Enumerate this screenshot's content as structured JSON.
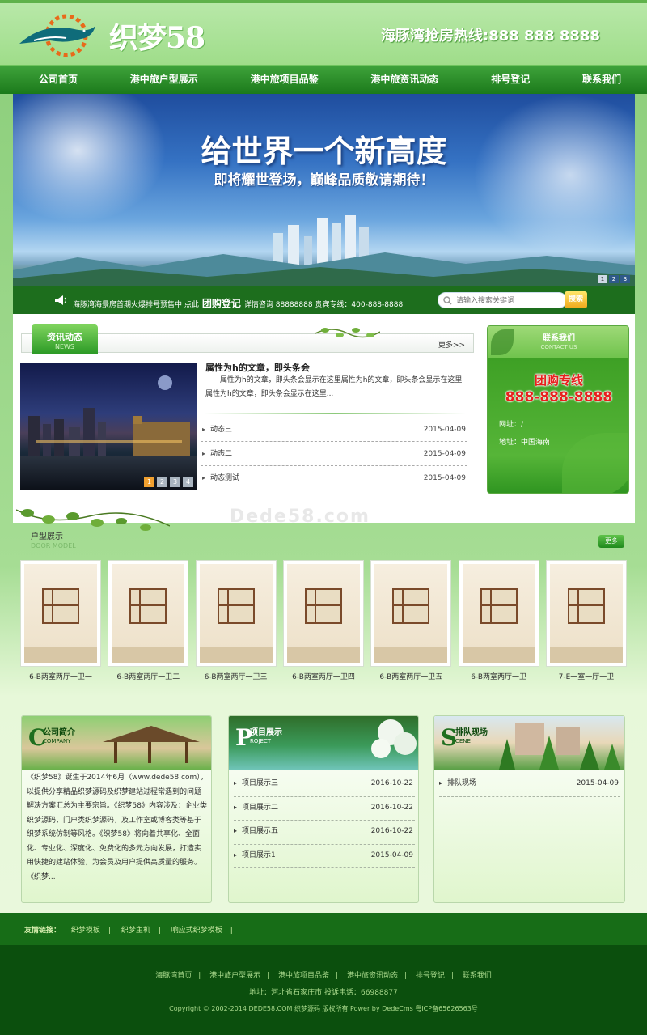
{
  "header": {
    "logo_text": "织梦58",
    "hotline": "海豚湾抢房热线:888 888 8888"
  },
  "nav": [
    "公司首页",
    "港中旅户型展示",
    "港中旅项目品鉴",
    "港中旅资讯动态",
    "排号登记",
    "联系我们"
  ],
  "banner": {
    "title": "给世界一个新高度",
    "subtitle": "即将耀世登场，巅峰品质敬请期待！",
    "dots": [
      "1",
      "2",
      "3"
    ]
  },
  "infobar": {
    "ticker_prefix": "海豚湾海景房首期火爆排号预售中  点此",
    "ticker_link": "团购登记",
    "ticker_suffix": "详情咨询 88888888 贵宾专线：400-888-8888",
    "search_placeholder": "请输入搜索关键词",
    "search_button": "搜索"
  },
  "news": {
    "tab_cn": "资讯动态",
    "tab_en": "NEWS",
    "more": "更多>>",
    "headline": "属性为h的文章，即头条会",
    "summary": "属性为h的文章，即头条会显示在这里属性为h的文章，即头条会显示在这里属性为h的文章，即头条会显示在这里...",
    "pager": [
      "1",
      "2",
      "3",
      "4"
    ],
    "items": [
      {
        "title": "动态三",
        "date": "2015-04-09"
      },
      {
        "title": "动态二",
        "date": "2015-04-09"
      },
      {
        "title": "动态测试一",
        "date": "2015-04-09"
      }
    ]
  },
  "contact": {
    "title_cn": "联系我们",
    "title_en": "CONTACT US",
    "tuangou": "团购专线",
    "phone": "888-888-8888",
    "url": "网址：/",
    "address": "地址：中国海南"
  },
  "watermark": "Dede58.com",
  "door": {
    "title_cn": "户型展示",
    "title_en": "DOOR MODEL",
    "more": "更多",
    "plans": [
      "6-B两室两厅一卫一",
      "6-B两室两厅一卫二",
      "6-B两室两厅一卫三",
      "6-B两室两厅一卫四",
      "6-B两室两厅一卫五",
      "6-B两室两厅一卫",
      "7-E一室一厅一卫"
    ]
  },
  "company": {
    "letter": "C",
    "title_cn": "公司简介",
    "title_en": "COMPANY",
    "text": "《织梦58》诞生于2014年6月（www.dede58.com），以提供分享精品织梦源码及织梦建站过程常遇到的问题解决方案汇总为主要宗旨。《织梦58》内容涉及：企业类织梦源码，门户类织梦源码，及工作室或博客类等基于织梦系统仿制等风格。《织梦58》将向着共享化、全面化、专业化、深度化、免费化的多元方向发展，打造实用快捷的建站体验，为会员及用户提供高质量的服务。《织梦..."
  },
  "project": {
    "letter": "P",
    "title_cn": "项目展示",
    "title_en": "ROJECT",
    "items": [
      {
        "title": "项目展示三",
        "date": "2016-10-22"
      },
      {
        "title": "项目展示二",
        "date": "2016-10-22"
      },
      {
        "title": "项目展示五",
        "date": "2016-10-22"
      },
      {
        "title": "项目展示1",
        "date": "2015-04-09"
      }
    ]
  },
  "scene": {
    "letter": "S",
    "title_cn": "排队现场",
    "title_en": "CENE",
    "items": [
      {
        "title": "排队现场",
        "date": "2015-04-09"
      }
    ]
  },
  "links": {
    "label": "友情链接：",
    "items": [
      "织梦模板",
      "织梦主机",
      "响应式织梦模板"
    ]
  },
  "footer": {
    "nav": [
      "海豚湾首页",
      "港中旅户型展示",
      "港中旅项目品鉴",
      "港中旅资讯动态",
      "排号登记",
      "联系我们"
    ],
    "address": "地址：河北省石家庄市       投诉电话：66988877",
    "copyright": "Copyright © 2002-2014 DEDE58.COM 织梦源码 版权所有 Power by DedeCms      粤ICP备65626563号"
  },
  "colors": {
    "brand_green": "#1e7e1f",
    "accent_red": "#e8201e",
    "accent_orange": "#f0a030"
  }
}
